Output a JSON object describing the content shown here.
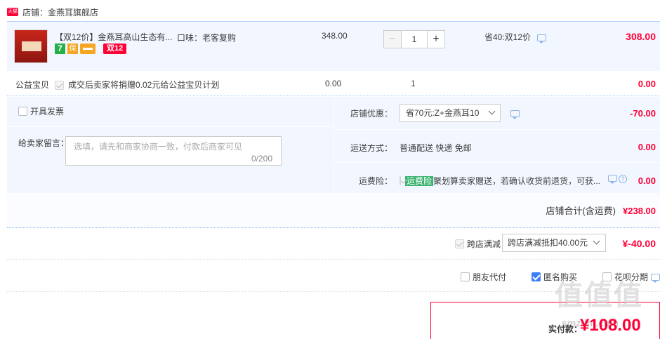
{
  "shop": {
    "badge": "天猫",
    "label": "店铺：金燕耳旗舰店"
  },
  "item": {
    "title": "【双12价】金燕耳高山生态有...",
    "flavor": "口味：老客复购",
    "unit_price": "348.00",
    "quantity": "1",
    "promo": "省40:双12价",
    "subtotal": "308.00",
    "badges": {
      "seven": "7",
      "shield": "保",
      "double12": "双12"
    }
  },
  "charity": {
    "label": "公益宝贝",
    "desc": "成交后卖家将捐赠0.02元给公益宝贝计划",
    "price": "0.00",
    "qty": "1",
    "total": "0.00"
  },
  "invoice": {
    "label": "开具发票"
  },
  "message": {
    "label": "给卖家留言：",
    "placeholder": "选填，请先和商家协商一致，付款后商家可见",
    "count": "0/200"
  },
  "shop_discount": {
    "label": "店铺优惠：",
    "selected": "省70元:Z+金燕耳10",
    "value": "-70.00"
  },
  "shipping": {
    "label": "运送方式：",
    "value": "普通配送 快递 免邮",
    "price": "0.00"
  },
  "insurance": {
    "label": "运费险：",
    "badge": "运费险",
    "text": "聚划算卖家赠送，若确认收货前退货，可获...",
    "price": "0.00"
  },
  "shop_total": {
    "label": "店铺合计(含运费)",
    "value": "¥238.00"
  },
  "cross_store": {
    "label": "跨店满减",
    "selected": "跨店满减抵扣40.00元",
    "value": "¥-40.00"
  },
  "options": {
    "friend": "朋友代付",
    "anonymous": "匿名购买",
    "huabei": "花呗分期"
  },
  "payment": {
    "label": "实付款：",
    "value": "¥108.00"
  },
  "watermark": {
    "main": "值值值",
    "sub": "smzdm.com"
  },
  "colors": {
    "accent": "#ff0036",
    "panel": "#f2f7ff",
    "link": "#3c7ef7"
  }
}
